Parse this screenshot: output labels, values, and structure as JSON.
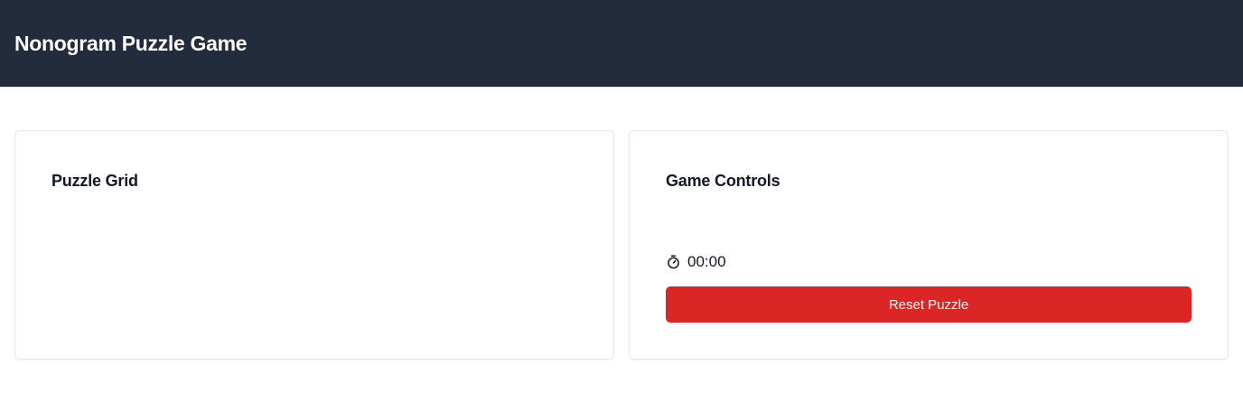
{
  "header": {
    "title": "Nonogram Puzzle Game",
    "background_color": "#222b3b"
  },
  "puzzle_panel": {
    "title": "Puzzle Grid"
  },
  "controls_panel": {
    "title": "Game Controls",
    "timer": {
      "icon": "stopwatch-icon",
      "value": "00:00"
    },
    "reset_button": {
      "label": "Reset Puzzle",
      "color": "#dc2626"
    }
  }
}
